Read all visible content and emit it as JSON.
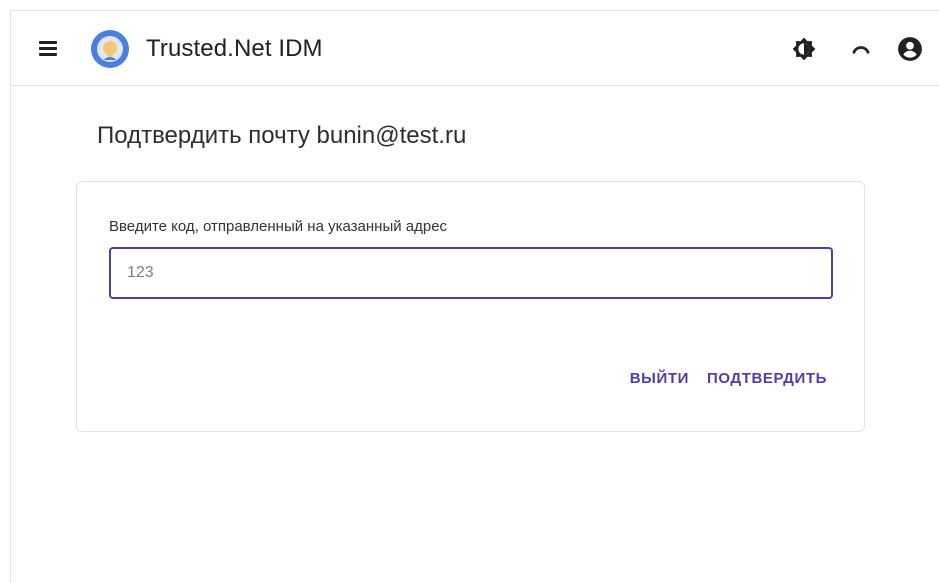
{
  "header": {
    "app_title": "Trusted.Net IDM",
    "icons": {
      "menu": "menu-icon",
      "logo": "app-logo",
      "theme": "theme-toggle-icon",
      "loading": "loading-spinner-icon",
      "account": "account-icon"
    }
  },
  "main": {
    "title": "Подтвердить почту bunin@test.ru",
    "form": {
      "label": "Введите код, отправленный на указанный адрес",
      "code_value": "123",
      "logout_label": "ВЫЙТИ",
      "confirm_label": "ПОДТВЕРДИТЬ"
    }
  },
  "colors": {
    "accent": "#4b3fa8",
    "logo_blue": "#4a7ee0",
    "text": "#212121"
  }
}
